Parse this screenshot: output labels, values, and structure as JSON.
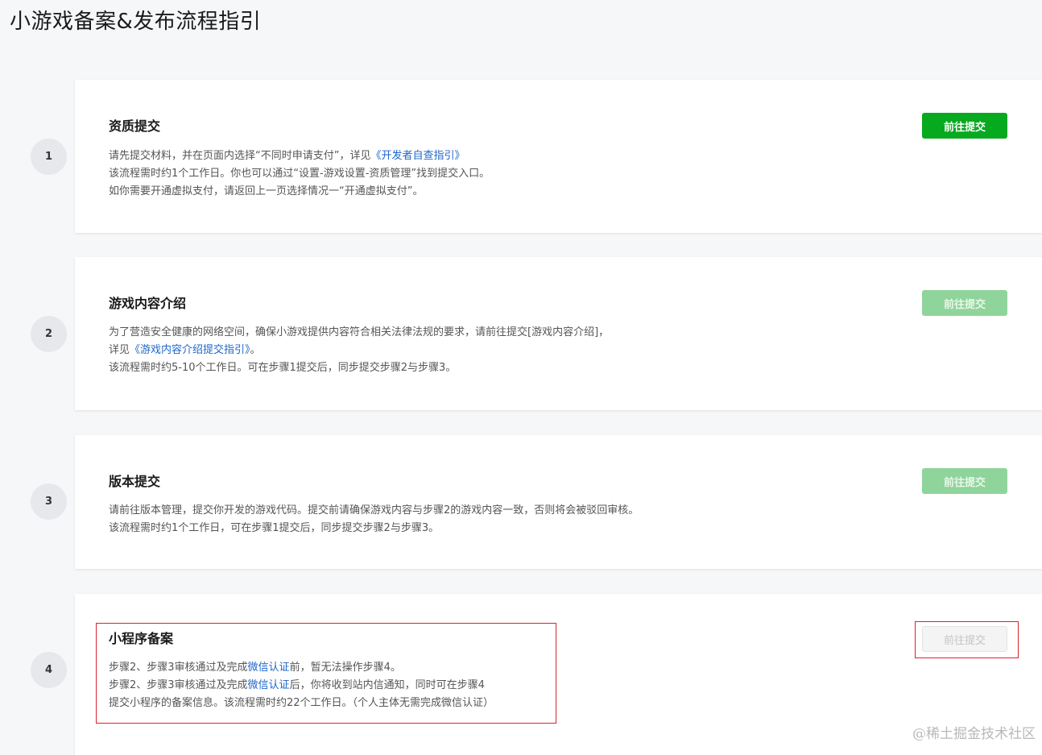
{
  "page": {
    "title": "小游戏备案&发布流程指引"
  },
  "steps": [
    {
      "number": "1",
      "title": "资质提交",
      "button": "前往提交",
      "lines": [
        {
          "pre": "请先提交材料，并在页面内选择“不同时申请支付”，详见",
          "link": "《开发者自查指引》",
          "post": ""
        },
        {
          "pre": "该流程需时约1个工作日。你也可以通过“设置-游戏设置-资质管理”找到提交入口。",
          "link": "",
          "post": ""
        },
        {
          "pre": "如你需要开通虚拟支付，请返回上一页选择情况一“开通虚拟支付”。",
          "link": "",
          "post": ""
        }
      ]
    },
    {
      "number": "2",
      "title": "游戏内容介绍",
      "button": "前往提交",
      "lines": [
        {
          "pre": "为了营造安全健康的网络空间，确保小游戏提供内容符合相关法律法规的要求，请前往提交[游戏内容介绍]，",
          "link": "",
          "post": ""
        },
        {
          "pre": "详见",
          "link": "《游戏内容介绍提交指引》",
          "post": "。"
        },
        {
          "pre": "该流程需时约5-10个工作日。可在步骤1提交后，同步提交步骤2与步骤3。",
          "link": "",
          "post": ""
        }
      ]
    },
    {
      "number": "3",
      "title": "版本提交",
      "button": "前往提交",
      "lines": [
        {
          "pre": "请前往版本管理，提交你开发的游戏代码。提交前请确保游戏内容与步骤2的游戏内容一致，否则将会被驳回审核。",
          "link": "",
          "post": ""
        },
        {
          "pre": "该流程需时约1个工作日，可在步骤1提交后，同步提交步骤2与步骤3。",
          "link": "",
          "post": ""
        }
      ]
    },
    {
      "number": "4",
      "title": "小程序备案",
      "button": "前往提交",
      "lines": [
        {
          "pre": "步骤2、步骤3审核通过及完成",
          "link": "微信认证",
          "post": "前，暂无法操作步骤4。"
        },
        {
          "pre": "步骤2、步骤3审核通过及完成",
          "link": "微信认证",
          "post": "后，你将收到站内信通知，同时可在步骤4"
        },
        {
          "pre": "提交小程序的备案信息。该流程需时约22个工作日。（个人主体无需完成微信认证）",
          "link": "",
          "post": ""
        }
      ]
    }
  ],
  "watermark": "@稀土掘金技术社区",
  "colors": {
    "primary_green": "#07a91f",
    "disabled_green": "#8fd49a",
    "link_blue": "#1e66c9",
    "highlight_red": "#d9232e"
  }
}
